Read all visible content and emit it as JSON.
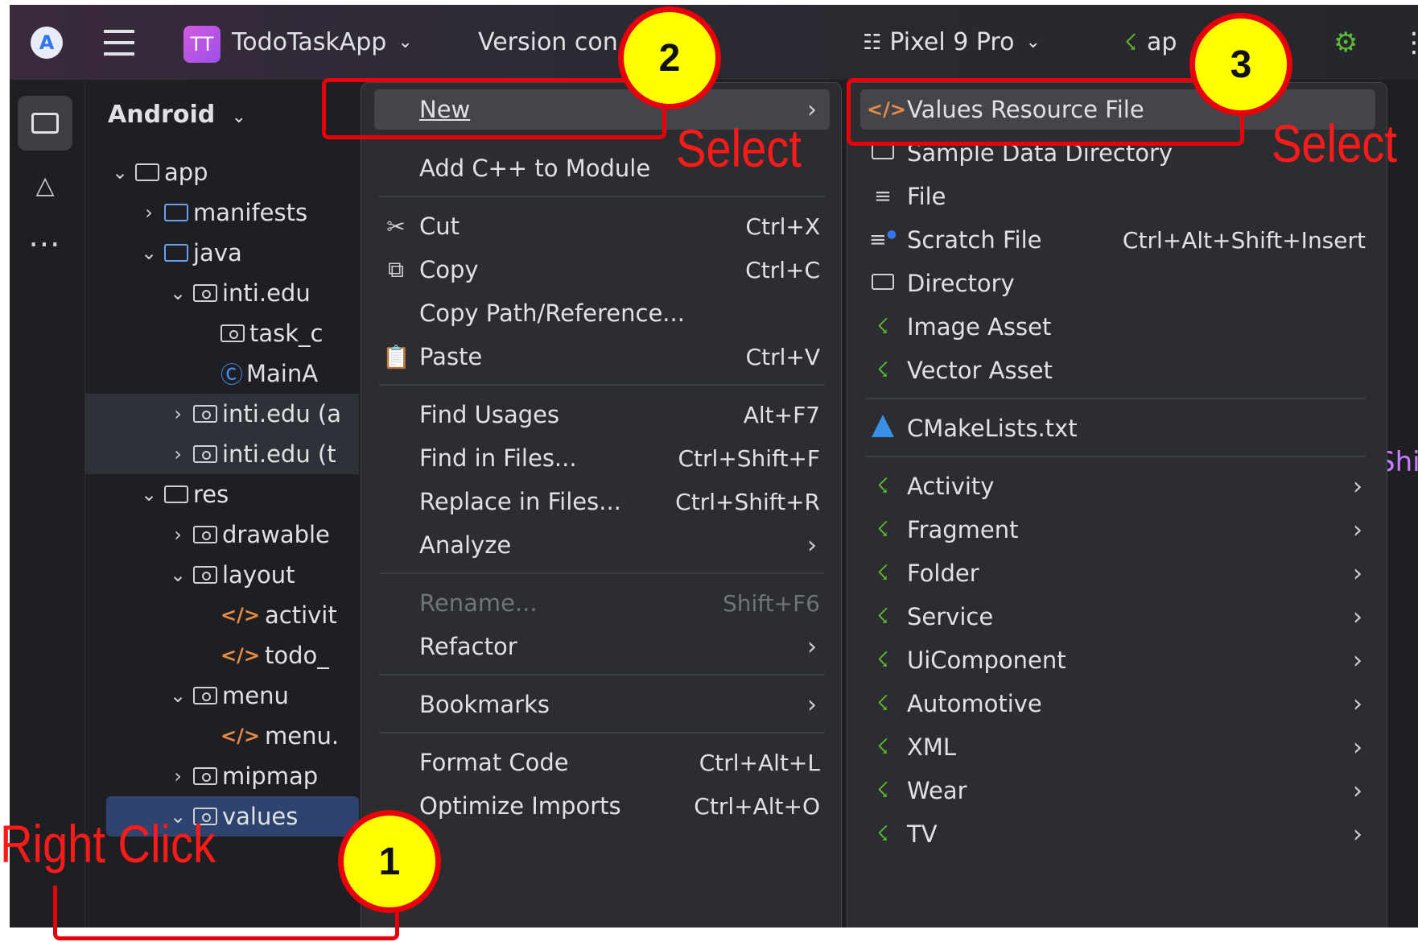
{
  "titlebar": {
    "project_initials": "TT",
    "project_name": "TodoTaskApp",
    "vcs_label": "Version con",
    "device": "Pixel 9 Pro",
    "run_config": "ap",
    "chevron": "⌄"
  },
  "tree": {
    "view_label": "Android",
    "rows": [
      {
        "label": "app"
      },
      {
        "label": "manifests"
      },
      {
        "label": "java"
      },
      {
        "label": "inti.edu"
      },
      {
        "label": "task_c"
      },
      {
        "label": "MainA"
      },
      {
        "label": "inti.edu (a"
      },
      {
        "label": "inti.edu (t"
      },
      {
        "label": "res"
      },
      {
        "label": "drawable"
      },
      {
        "label": "layout"
      },
      {
        "label": "activit"
      },
      {
        "label": "todo_"
      },
      {
        "label": "menu"
      },
      {
        "label": "menu."
      },
      {
        "label": "mipmap"
      },
      {
        "label": "values"
      }
    ]
  },
  "menu": {
    "items": [
      {
        "label": "New",
        "shortcut": ""
      },
      {
        "label": "Add C++ to Module",
        "shortcut": ""
      },
      {
        "label": "Cut",
        "shortcut": "Ctrl+X"
      },
      {
        "label": "Copy",
        "shortcut": "Ctrl+C"
      },
      {
        "label": "Copy Path/Reference...",
        "shortcut": ""
      },
      {
        "label": "Paste",
        "shortcut": "Ctrl+V"
      },
      {
        "label": "Find Usages",
        "shortcut": "Alt+F7"
      },
      {
        "label": "Find in Files...",
        "shortcut": "Ctrl+Shift+F"
      },
      {
        "label": "Replace in Files...",
        "shortcut": "Ctrl+Shift+R"
      },
      {
        "label": "Analyze",
        "shortcut": ""
      },
      {
        "label": "Rename...",
        "shortcut": "Shift+F6"
      },
      {
        "label": "Refactor",
        "shortcut": ""
      },
      {
        "label": "Bookmarks",
        "shortcut": ""
      },
      {
        "label": "Format Code",
        "shortcut": "Ctrl+Alt+L"
      },
      {
        "label": "Optimize Imports",
        "shortcut": "Ctrl+Alt+O"
      }
    ]
  },
  "submenu": {
    "items": [
      {
        "label": "Values Resource File",
        "shortcut": ""
      },
      {
        "label": "Sample Data Directory",
        "shortcut": ""
      },
      {
        "label": "File",
        "shortcut": ""
      },
      {
        "label": "Scratch File",
        "shortcut": "Ctrl+Alt+Shift+Insert"
      },
      {
        "label": "Directory",
        "shortcut": ""
      },
      {
        "label": "Image Asset",
        "shortcut": ""
      },
      {
        "label": "Vector Asset",
        "shortcut": ""
      },
      {
        "label": "CMakeLists.txt",
        "shortcut": ""
      },
      {
        "label": "Activity",
        "shortcut": ""
      },
      {
        "label": "Fragment",
        "shortcut": ""
      },
      {
        "label": "Folder",
        "shortcut": ""
      },
      {
        "label": "Service",
        "shortcut": ""
      },
      {
        "label": "UiComponent",
        "shortcut": ""
      },
      {
        "label": "Automotive",
        "shortcut": ""
      },
      {
        "label": "XML",
        "shortcut": ""
      },
      {
        "label": "Wear",
        "shortcut": ""
      },
      {
        "label": "TV",
        "shortcut": ""
      }
    ]
  },
  "background_peek": "Shi",
  "annotations": {
    "step1_number": "1",
    "step1_text": "Right Click",
    "step2_number": "2",
    "step2_text": "Select",
    "step3_number": "3",
    "step3_text": "Select",
    "color": "#e8000b",
    "badge_color": "#ffff00"
  }
}
